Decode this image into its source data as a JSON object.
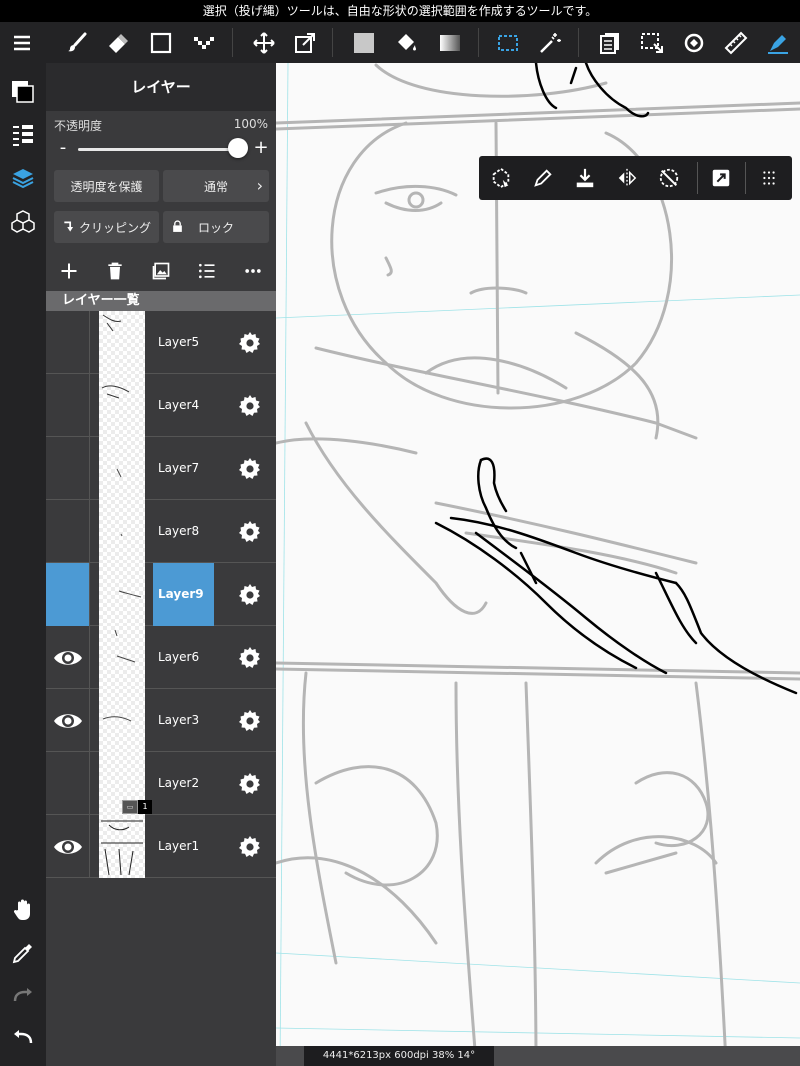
{
  "hint_bar": {
    "text": "選択（投げ縄）ツールは、自由な形状の選択範囲を作成するツールです。"
  },
  "toolbar": {
    "icons": [
      "menu-icon",
      "brush-icon",
      "eraser-icon",
      "rectangle-icon",
      "dot-brush-icon",
      "move-icon",
      "transform-icon",
      "fill-color-icon",
      "bucket-icon",
      "gradient-icon",
      "rect-select-icon",
      "magic-wand-icon",
      "pages-icon",
      "select-layer-icon",
      "rotate-icon",
      "ruler-icon",
      "pen-active-icon"
    ],
    "active_color": "#3aa3e3"
  },
  "left_sidebar": {
    "items": [
      "color-swatch",
      "layer-property-icon",
      "layers-icon",
      "material-icon",
      "hand-icon",
      "eyedropper-icon",
      "redo-icon",
      "undo-icon"
    ]
  },
  "layer_panel": {
    "title": "レイヤー",
    "opacity_label": "不透明度",
    "opacity_value": "100%",
    "opacity_fraction": 1.0,
    "minus": "-",
    "plus": "+",
    "protect_alpha": "透明度を保護",
    "blend_mode": "通常",
    "clipping": "クリッピング",
    "lock": "ロック",
    "list_header": "レイヤー一覧",
    "selected_color": "#4c9ad4",
    "layers": [
      {
        "name": "Layer5",
        "visible": false,
        "selected": false
      },
      {
        "name": "Layer4",
        "visible": false,
        "selected": false
      },
      {
        "name": "Layer7",
        "visible": false,
        "selected": false
      },
      {
        "name": "Layer8",
        "visible": false,
        "selected": false
      },
      {
        "name": "Layer9",
        "visible": false,
        "selected": true
      },
      {
        "name": "Layer6",
        "visible": true,
        "selected": false
      },
      {
        "name": "Layer3",
        "visible": true,
        "selected": false
      },
      {
        "name": "Layer2",
        "visible": false,
        "selected": false,
        "folder_count": "1"
      },
      {
        "name": "Layer1",
        "visible": true,
        "selected": false
      }
    ]
  },
  "status_bar": {
    "text": "4441*6213px 600dpi 38% 14°"
  }
}
